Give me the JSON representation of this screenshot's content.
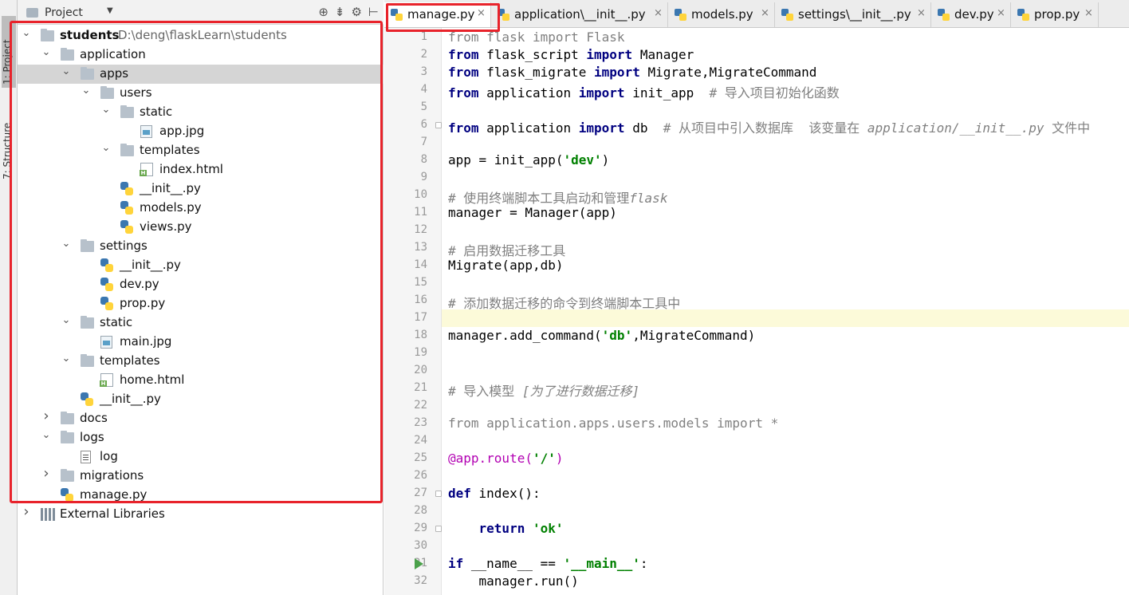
{
  "side_strip": {
    "project_tab": "1: Project",
    "structure_tab": "7: Structure"
  },
  "project_panel": {
    "title": "Project",
    "tree": [
      {
        "label": "students",
        "path": "D:\\deng\\flaskLearn\\students",
        "type": "folder",
        "expanded": true,
        "bold": true
      },
      {
        "label": "application",
        "type": "folder",
        "expanded": true
      },
      {
        "label": "apps",
        "type": "folder",
        "expanded": true,
        "selected": true
      },
      {
        "label": "users",
        "type": "folder",
        "expanded": true
      },
      {
        "label": "static",
        "type": "folder",
        "expanded": true
      },
      {
        "label": "app.jpg",
        "type": "image"
      },
      {
        "label": "templates",
        "type": "folder",
        "expanded": true
      },
      {
        "label": "index.html",
        "type": "html"
      },
      {
        "label": "__init__.py",
        "type": "python"
      },
      {
        "label": "models.py",
        "type": "python"
      },
      {
        "label": "views.py",
        "type": "python"
      },
      {
        "label": "settings",
        "type": "folder",
        "expanded": true
      },
      {
        "label": "__init__.py",
        "type": "python"
      },
      {
        "label": "dev.py",
        "type": "python"
      },
      {
        "label": "prop.py",
        "type": "python"
      },
      {
        "label": "static",
        "type": "folder",
        "expanded": true
      },
      {
        "label": "main.jpg",
        "type": "image"
      },
      {
        "label": "templates",
        "type": "folder",
        "expanded": true
      },
      {
        "label": "home.html",
        "type": "html"
      },
      {
        "label": "__init__.py",
        "type": "python"
      },
      {
        "label": "docs",
        "type": "folder"
      },
      {
        "label": "logs",
        "type": "folder",
        "expanded": true
      },
      {
        "label": "log",
        "type": "text"
      },
      {
        "label": "migrations",
        "type": "folder",
        "expanded": false
      },
      {
        "label": "manage.py",
        "type": "python"
      },
      {
        "label": "External Libraries",
        "type": "library",
        "expanded": false
      }
    ]
  },
  "editor": {
    "tabs": [
      {
        "label": "manage.py",
        "active": true
      },
      {
        "label": "application\\__init__.py"
      },
      {
        "label": "models.py"
      },
      {
        "label": "settings\\__init__.py"
      },
      {
        "label": "dev.py"
      },
      {
        "label": "prop.py"
      }
    ],
    "close_glyph": "×",
    "current_line": 17,
    "lines": [
      {
        "n": "1",
        "tokens": [
          [
            "from",
            "dim"
          ],
          [
            " flask ",
            "dim"
          ],
          [
            "import",
            "dim"
          ],
          [
            " Flask",
            "dim"
          ]
        ]
      },
      {
        "n": "2",
        "tokens": [
          [
            "from",
            "kw"
          ],
          [
            " flask_script ",
            "name"
          ],
          [
            "import",
            "kw"
          ],
          [
            " Manager",
            "name"
          ]
        ]
      },
      {
        "n": "3",
        "tokens": [
          [
            "from",
            "kw"
          ],
          [
            " flask_migrate ",
            "name"
          ],
          [
            "import",
            "kw"
          ],
          [
            " Migrate,MigrateCommand",
            "name"
          ]
        ]
      },
      {
        "n": "4",
        "tokens": [
          [
            "from",
            "kw"
          ],
          [
            " application ",
            "name"
          ],
          [
            "import",
            "kw"
          ],
          [
            " init_app  ",
            "name"
          ],
          [
            "# 导入项目初始化函数",
            "cmt"
          ]
        ]
      },
      {
        "n": "5",
        "tokens": []
      },
      {
        "n": "6",
        "tokens": [
          [
            "from",
            "kw"
          ],
          [
            " application ",
            "name"
          ],
          [
            "import",
            "kw"
          ],
          [
            " db  ",
            "name"
          ],
          [
            "# 从项目中引入数据库  该变量在 ",
            "cmt"
          ],
          [
            "application/__init__.py",
            "cmtit"
          ],
          [
            " 文件中",
            "cmt"
          ]
        ]
      },
      {
        "n": "7",
        "tokens": []
      },
      {
        "n": "8",
        "tokens": [
          [
            "app = init_app(",
            "name"
          ],
          [
            "'dev'",
            "str"
          ],
          [
            ")",
            "name"
          ]
        ]
      },
      {
        "n": "9",
        "tokens": []
      },
      {
        "n": "10",
        "tokens": [
          [
            "# 使用终端脚本工具启动和管理",
            "cmt"
          ],
          [
            "flask",
            "cmtit"
          ]
        ]
      },
      {
        "n": "11",
        "tokens": [
          [
            "manager = Manager(app)",
            "name"
          ]
        ]
      },
      {
        "n": "12",
        "tokens": []
      },
      {
        "n": "13",
        "tokens": [
          [
            "# 启用数据迁移工具",
            "cmt"
          ]
        ]
      },
      {
        "n": "14",
        "tokens": [
          [
            "Migrate(app,db)",
            "name"
          ]
        ]
      },
      {
        "n": "15",
        "tokens": []
      },
      {
        "n": "16",
        "tokens": [
          [
            "# 添加数据迁移的命令到终端脚本工具中",
            "cmt"
          ]
        ]
      },
      {
        "n": "17",
        "tokens": []
      },
      {
        "n": "18",
        "tokens": [
          [
            "manager.add_command(",
            "name"
          ],
          [
            "'db'",
            "str"
          ],
          [
            ",MigrateCommand)",
            "name"
          ]
        ]
      },
      {
        "n": "19",
        "tokens": []
      },
      {
        "n": "20",
        "tokens": []
      },
      {
        "n": "21",
        "tokens": [
          [
            "# 导入模型 ",
            "cmt"
          ],
          [
            "[为了进行数据迁移]",
            "cmtit"
          ]
        ]
      },
      {
        "n": "22",
        "tokens": []
      },
      {
        "n": "23",
        "tokens": [
          [
            "from",
            "dim"
          ],
          [
            " application.apps.users.models ",
            "dim"
          ],
          [
            "import",
            "dim"
          ],
          [
            " *",
            "dim"
          ]
        ]
      },
      {
        "n": "24",
        "tokens": []
      },
      {
        "n": "25",
        "tokens": [
          [
            "@app.route(",
            "deco"
          ],
          [
            "'/'",
            "str"
          ],
          [
            ")",
            "deco"
          ]
        ]
      },
      {
        "n": "26",
        "tokens": []
      },
      {
        "n": "27",
        "tokens": [
          [
            "def",
            "kw"
          ],
          [
            " index():",
            "name"
          ]
        ]
      },
      {
        "n": "28",
        "tokens": []
      },
      {
        "n": "29",
        "tokens": [
          [
            "    ",
            "name"
          ],
          [
            "return",
            "kw"
          ],
          [
            " ",
            "name"
          ],
          [
            "'ok'",
            "str"
          ]
        ]
      },
      {
        "n": "30",
        "tokens": []
      },
      {
        "n": "31",
        "tokens": [
          [
            "if",
            "kw"
          ],
          [
            " __name__ == ",
            "name"
          ],
          [
            "'__main__'",
            "str"
          ],
          [
            ":",
            "name"
          ]
        ]
      },
      {
        "n": "32",
        "tokens": [
          [
            "    manager.run()",
            "name"
          ]
        ]
      }
    ]
  },
  "colors": {
    "highlight_border": "#e8232b",
    "keyword": "#000080",
    "string": "#008000",
    "comment": "#808080",
    "decorator": "#b200b2",
    "selection": "#d5d5d5",
    "current_line": "#fcfad9"
  }
}
